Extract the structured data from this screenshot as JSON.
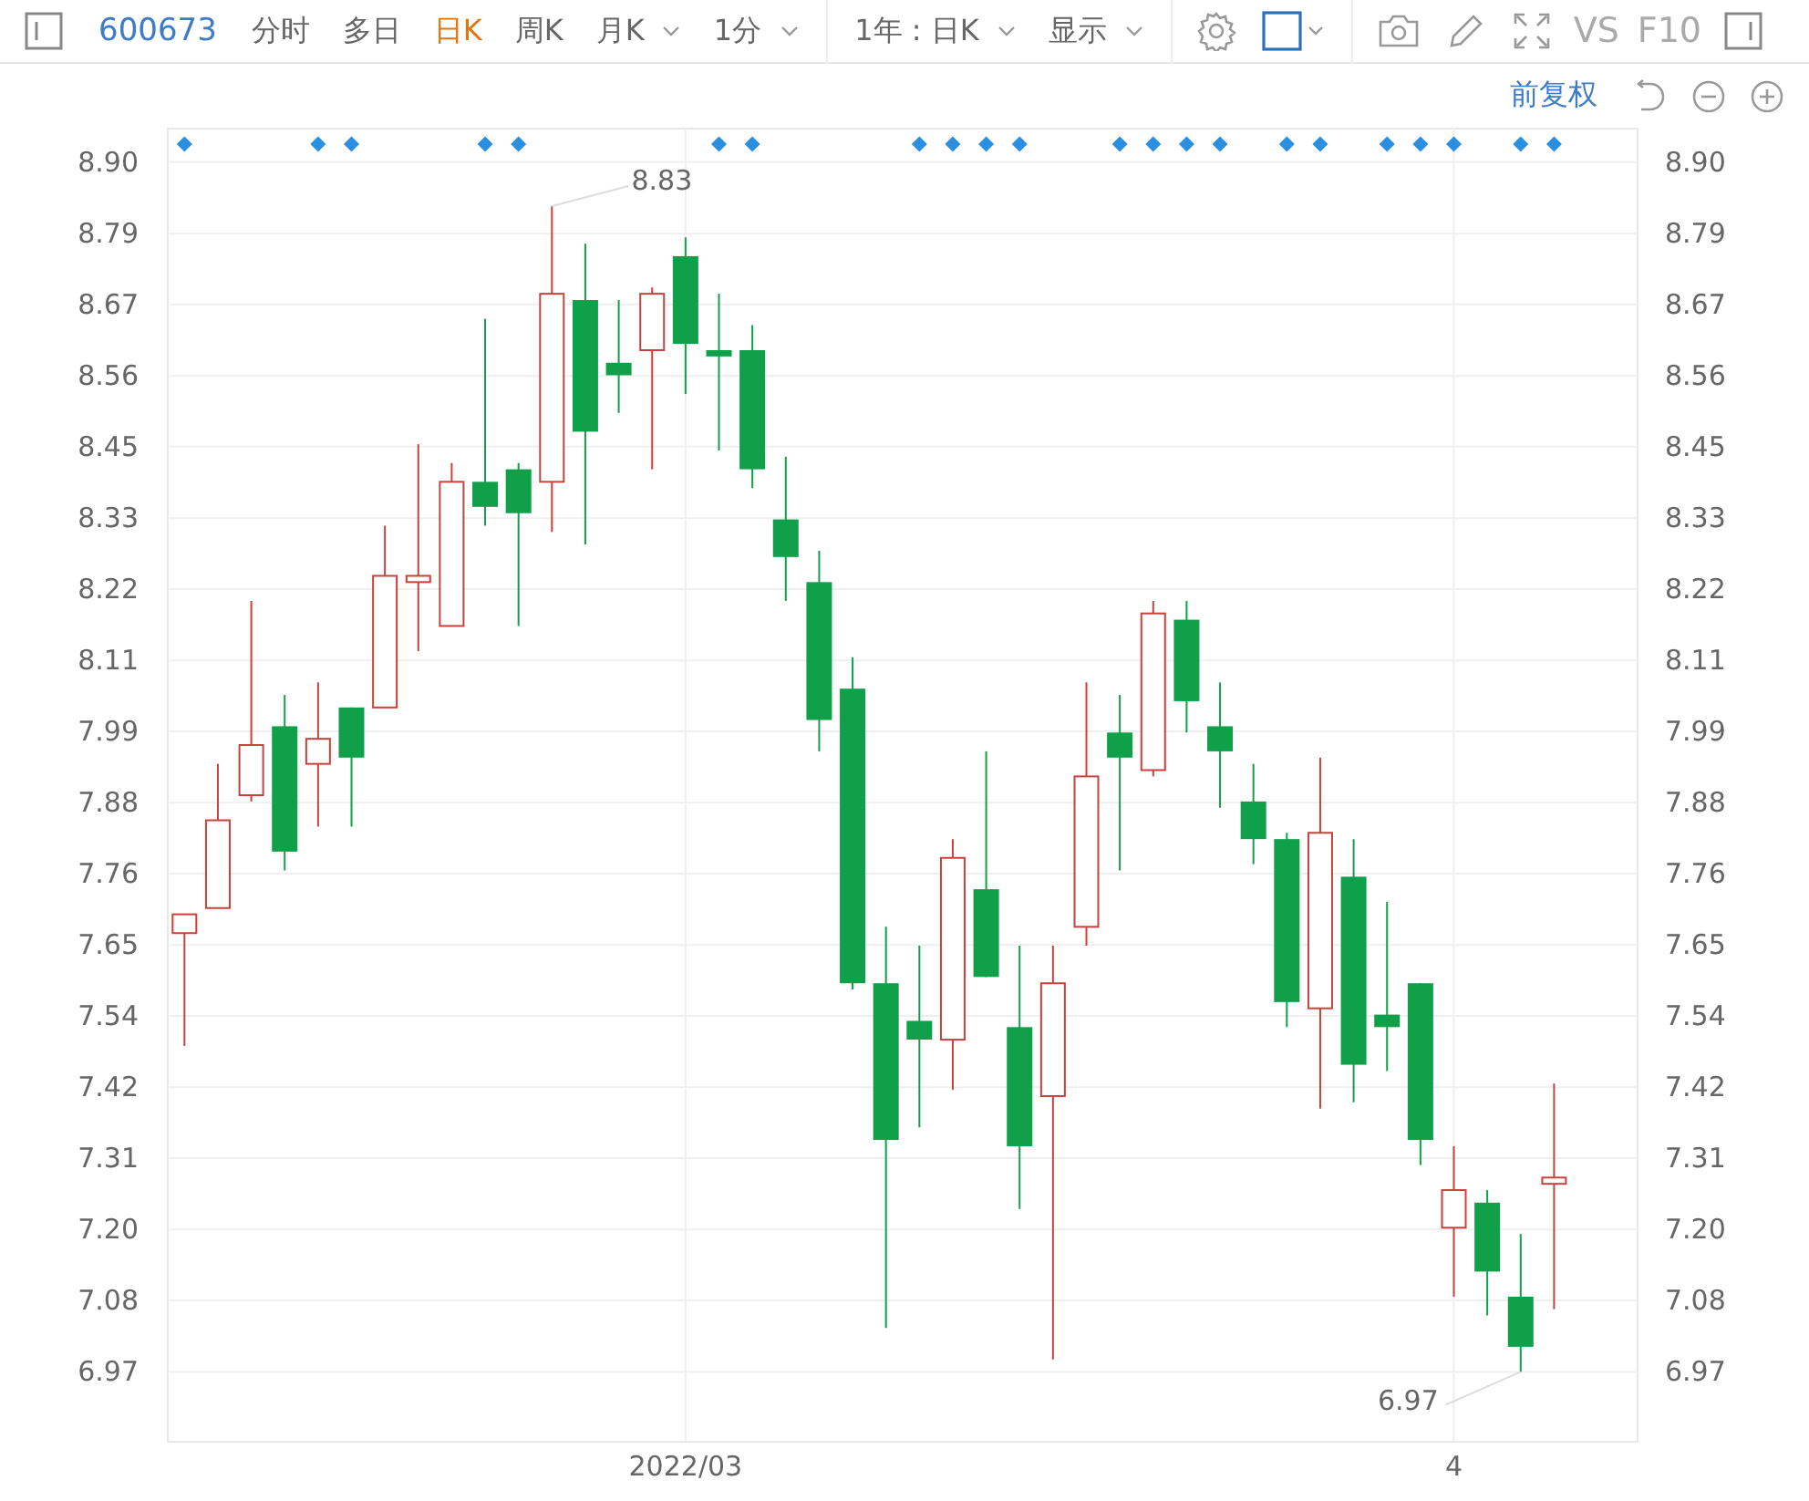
{
  "toolbar": {
    "code": "600673",
    "tabs": [
      {
        "label": "分时",
        "selected": false,
        "kind": "tab"
      },
      {
        "label": "多日",
        "selected": false,
        "kind": "tab"
      },
      {
        "label": "日K",
        "selected": true,
        "kind": "tab"
      },
      {
        "label": "周K",
        "selected": false,
        "kind": "tab"
      },
      {
        "label": "月K",
        "selected": false,
        "kind": "dropdown"
      },
      {
        "label": "1分",
        "selected": false,
        "kind": "dropdown"
      }
    ],
    "range": "1年 : 日K",
    "display": "显示",
    "vs": "VS",
    "f10": "F10"
  },
  "chart": {
    "adjust": "前复权",
    "markers": [
      {
        "on": true
      },
      {
        "on": false
      },
      {
        "on": false
      },
      {
        "on": false
      },
      {
        "on": true
      },
      {
        "on": true
      },
      {
        "on": false
      },
      {
        "on": false
      },
      {
        "on": false
      },
      {
        "on": true
      },
      {
        "on": true
      },
      {
        "on": false
      },
      {
        "on": false
      },
      {
        "on": false
      },
      {
        "on": false
      },
      {
        "on": false
      },
      {
        "on": true
      },
      {
        "on": true
      },
      {
        "on": false
      },
      {
        "on": false
      },
      {
        "on": false
      },
      {
        "on": false
      },
      {
        "on": true
      },
      {
        "on": true
      },
      {
        "on": true
      },
      {
        "on": true
      },
      {
        "on": false
      },
      {
        "on": false
      },
      {
        "on": true
      },
      {
        "on": true
      },
      {
        "on": true
      },
      {
        "on": true
      },
      {
        "on": false
      },
      {
        "on": true
      },
      {
        "on": true
      },
      {
        "on": false
      },
      {
        "on": true
      },
      {
        "on": true
      },
      {
        "on": true
      },
      {
        "on": false
      },
      {
        "on": true
      },
      {
        "on": true
      }
    ],
    "chart_data": {
      "type": "candlestick",
      "grid": true,
      "categories": [
        null,
        null,
        null,
        null,
        null,
        null,
        null,
        null,
        null,
        null,
        null,
        null,
        null,
        null,
        null,
        "2022/03",
        null,
        null,
        null,
        null,
        null,
        null,
        null,
        null,
        null,
        null,
        null,
        null,
        null,
        null,
        null,
        null,
        null,
        null,
        null,
        null,
        null,
        null,
        "4",
        null,
        null,
        null,
        null,
        null
      ],
      "ohlc": [
        [
          7.67,
          7.7,
          7.49,
          7.7
        ],
        [
          7.71,
          7.94,
          7.71,
          7.85
        ],
        [
          7.89,
          8.2,
          7.88,
          7.97
        ],
        [
          8.0,
          8.05,
          7.77,
          7.8
        ],
        [
          7.94,
          8.07,
          7.84,
          7.98
        ],
        [
          8.03,
          8.03,
          7.84,
          7.95
        ],
        [
          8.03,
          8.32,
          8.03,
          8.24
        ],
        [
          8.23,
          8.45,
          8.12,
          8.24
        ],
        [
          8.16,
          8.42,
          8.16,
          8.39
        ],
        [
          8.39,
          8.65,
          8.32,
          8.35
        ],
        [
          8.41,
          8.42,
          8.16,
          8.34
        ],
        [
          8.39,
          8.83,
          8.31,
          8.69
        ],
        [
          8.68,
          8.77,
          8.29,
          8.47
        ],
        [
          8.58,
          8.68,
          8.5,
          8.56
        ],
        [
          8.6,
          8.7,
          8.41,
          8.69
        ],
        [
          8.75,
          8.78,
          8.53,
          8.61
        ],
        [
          8.6,
          8.69,
          8.44,
          8.59
        ],
        [
          8.6,
          8.64,
          8.38,
          8.41
        ],
        [
          8.33,
          8.43,
          8.2,
          8.27
        ],
        [
          8.23,
          8.28,
          7.96,
          8.01
        ],
        [
          8.06,
          8.11,
          7.58,
          7.59
        ],
        [
          7.59,
          7.68,
          7.04,
          7.34
        ],
        [
          7.53,
          7.65,
          7.36,
          7.5
        ],
        [
          7.5,
          7.82,
          7.42,
          7.79
        ],
        [
          7.74,
          7.96,
          7.6,
          7.6
        ],
        [
          7.52,
          7.65,
          7.23,
          7.33
        ],
        [
          7.41,
          7.65,
          6.99,
          7.59
        ],
        [
          7.68,
          8.07,
          7.65,
          7.92
        ],
        [
          7.99,
          8.05,
          7.77,
          7.95
        ],
        [
          7.93,
          8.2,
          7.92,
          8.18
        ],
        [
          8.17,
          8.2,
          7.99,
          8.04
        ],
        [
          8.0,
          8.07,
          7.87,
          7.96
        ],
        [
          7.88,
          7.94,
          7.78,
          7.82
        ],
        [
          7.82,
          7.83,
          7.52,
          7.56
        ],
        [
          7.55,
          7.95,
          7.39,
          7.83
        ],
        [
          7.76,
          7.82,
          7.4,
          7.46
        ],
        [
          7.54,
          7.72,
          7.45,
          7.52
        ],
        [
          7.59,
          7.59,
          7.3,
          7.34
        ],
        [
          7.2,
          7.33,
          7.09,
          7.26
        ],
        [
          7.24,
          7.26,
          7.06,
          7.13
        ],
        [
          7.09,
          7.19,
          6.97,
          7.01
        ],
        [
          7.27,
          7.43,
          7.07,
          7.28
        ],
        null,
        null
      ],
      "ylim": [
        6.86,
        8.955
      ],
      "y2lim": [
        6.86,
        8.955
      ],
      "yticks": [
        {
          "value": 8.9,
          "label": "8.90"
        },
        {
          "value": 8.786,
          "label": "8.79"
        },
        {
          "value": 8.673,
          "label": "8.67"
        },
        {
          "value": 8.559,
          "label": "8.56"
        },
        {
          "value": 8.446,
          "label": "8.45"
        },
        {
          "value": 8.332,
          "label": "8.33"
        },
        {
          "value": 8.219,
          "label": "8.22"
        },
        {
          "value": 8.105,
          "label": "8.11"
        },
        {
          "value": 7.992,
          "label": "7.99"
        },
        {
          "value": 7.878,
          "label": "7.88"
        },
        {
          "value": 7.765,
          "label": "7.76"
        },
        {
          "value": 7.651,
          "label": "7.65"
        },
        {
          "value": 7.538,
          "label": "7.54"
        },
        {
          "value": 7.424,
          "label": "7.42"
        },
        {
          "value": 7.311,
          "label": "7.31"
        },
        {
          "value": 7.197,
          "label": "7.20"
        },
        {
          "value": 7.084,
          "label": "7.08"
        },
        {
          "value": 6.97,
          "label": "6.97"
        }
      ],
      "y2ticks": [
        {
          "value": 8.9,
          "label": "8.90"
        },
        {
          "value": 8.786,
          "label": "8.79"
        },
        {
          "value": 8.673,
          "label": "8.67"
        },
        {
          "value": 8.559,
          "label": "8.56"
        },
        {
          "value": 8.446,
          "label": "8.45"
        },
        {
          "value": 8.332,
          "label": "8.33"
        },
        {
          "value": 8.219,
          "label": "8.22"
        },
        {
          "value": 8.105,
          "label": "8.11"
        },
        {
          "value": 7.992,
          "label": "7.99"
        },
        {
          "value": 7.878,
          "label": "7.88"
        },
        {
          "value": 7.765,
          "label": "7.76"
        },
        {
          "value": 7.651,
          "label": "7.65"
        },
        {
          "value": 7.538,
          "label": "7.54"
        },
        {
          "value": 7.424,
          "label": "7.42"
        },
        {
          "value": 7.311,
          "label": "7.31"
        },
        {
          "value": 7.197,
          "label": "7.20"
        },
        {
          "value": 7.084,
          "label": "7.08"
        },
        {
          "value": 6.97,
          "label": "6.97"
        }
      ],
      "annotations": [
        "8.83",
        "6.97"
      ]
    }
  }
}
